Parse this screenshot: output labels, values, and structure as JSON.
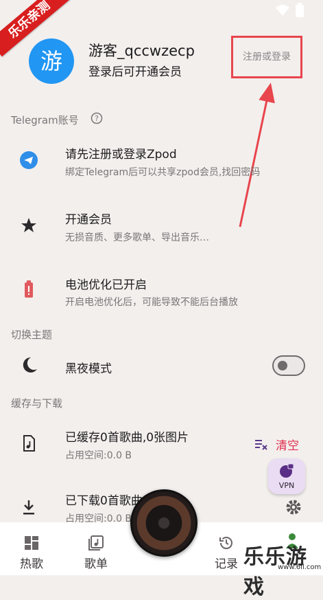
{
  "ribbon": {
    "text": "乐乐亲测"
  },
  "profile": {
    "avatar_char": "游",
    "username": "游客_qccwzecp",
    "subtitle": "登录后可开通会员",
    "login_button": "注册或登录"
  },
  "sections": {
    "telegram": "Telegram账号",
    "theme": "切换主题",
    "cache": "缓存与下载"
  },
  "rows": {
    "telegram": {
      "title": "请先注册或登录Zpod",
      "subtitle": "绑定Telegram后可以共享zpod会员,找回密码"
    },
    "vip": {
      "title": "开通会员",
      "subtitle": "无损音质、更多歌单、导出音乐…"
    },
    "battery": {
      "title": "电池优化已开启",
      "subtitle": "开启电池优化后，可能导致不能后台播放"
    },
    "dark": {
      "title": "黑夜模式",
      "enabled": false
    },
    "cached": {
      "title": "已缓存0首歌曲,0张图片",
      "subtitle": "占用空间:0.0 B",
      "action": "清空"
    },
    "downloaded": {
      "title": "已下载0首歌曲",
      "subtitle": "占用空间:0.0 B"
    }
  },
  "vpn": {
    "label": "VPN"
  },
  "nav": {
    "hot": "热歌",
    "playlist": "歌单",
    "history": "记录"
  },
  "colors": {
    "accent_red": "#e0304e",
    "avatar_blue": "#2196f3",
    "telegram_blue": "#2f8ee8",
    "battery_red": "#e05a5e",
    "vpn_purple": "#5a2d86"
  },
  "watermark": {
    "logo": "乐乐游戏",
    "url": "www.6ll.com"
  }
}
